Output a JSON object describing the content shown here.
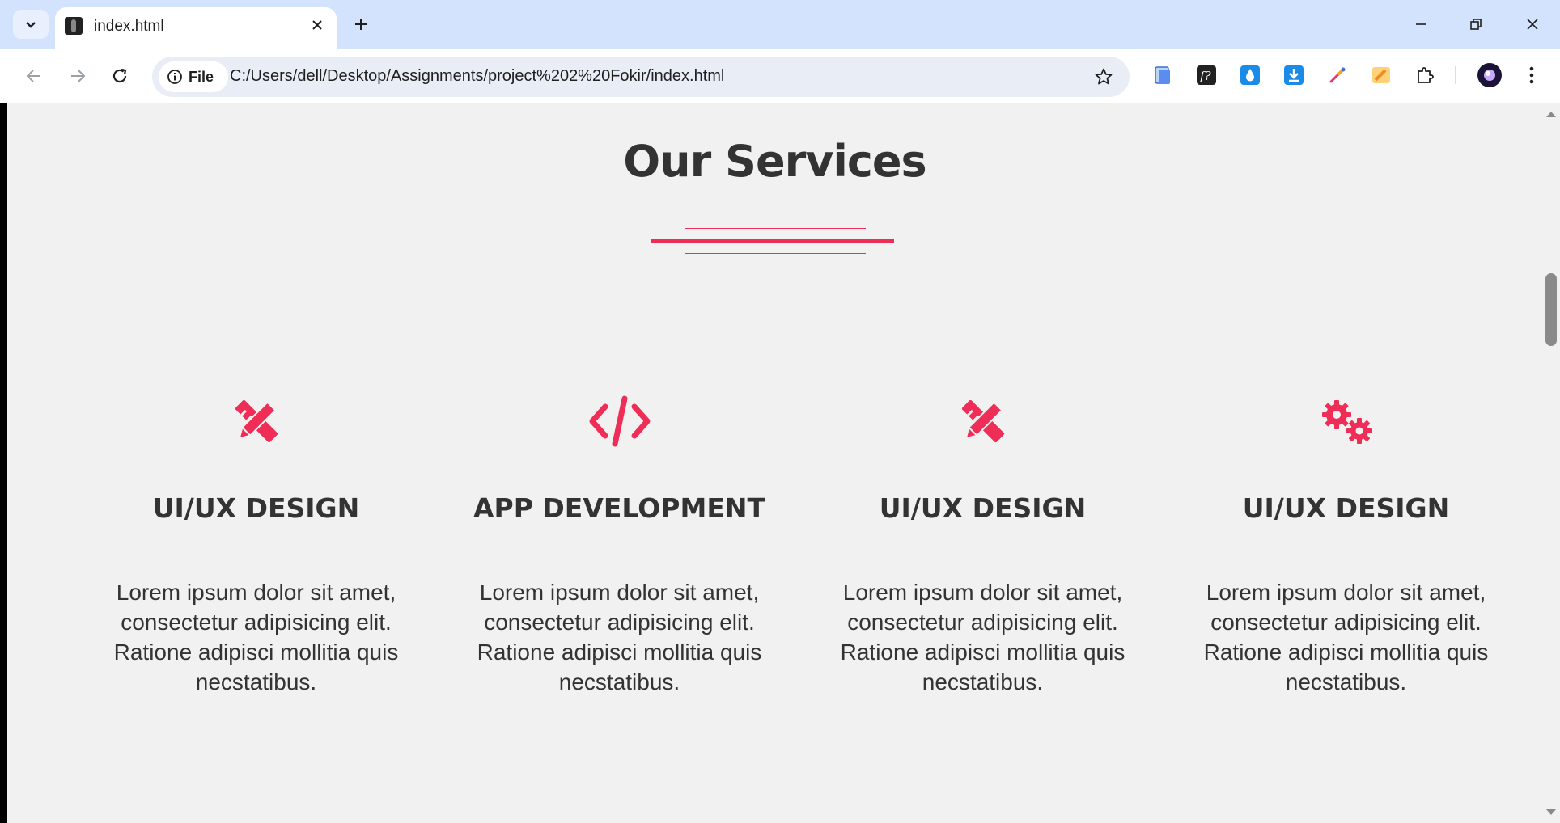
{
  "browser": {
    "tab_title": "index.html",
    "site_chip_label": "File",
    "url": "C:/Users/dell/Desktop/Assignments/project%202%20Fokir/index.html"
  },
  "page": {
    "section_title": "Our Services",
    "accent_color": "#ef2d56",
    "services": [
      {
        "icon": "pencil-ruler-icon",
        "title": "UI/UX DESIGN",
        "text": "Lorem ipsum dolor sit amet, consectetur adipisicing elit. Ratione adipisci mollitia quis necstatibus."
      },
      {
        "icon": "code-icon",
        "title": "APP DEVELOPMENT",
        "text": "Lorem ipsum dolor sit amet, consectetur adipisicing elit. Ratione adipisci mollitia quis necstatibus."
      },
      {
        "icon": "pencil-ruler-icon",
        "title": "UI/UX DESIGN",
        "text": "Lorem ipsum dolor sit amet, consectetur adipisicing elit. Ratione adipisci mollitia quis necstatibus."
      },
      {
        "icon": "gears-icon",
        "title": "UI/UX DESIGN",
        "text": "Lorem ipsum dolor sit amet, consectetur adipisicing elit. Ratione adipisci mollitia quis necstatibus."
      }
    ]
  }
}
